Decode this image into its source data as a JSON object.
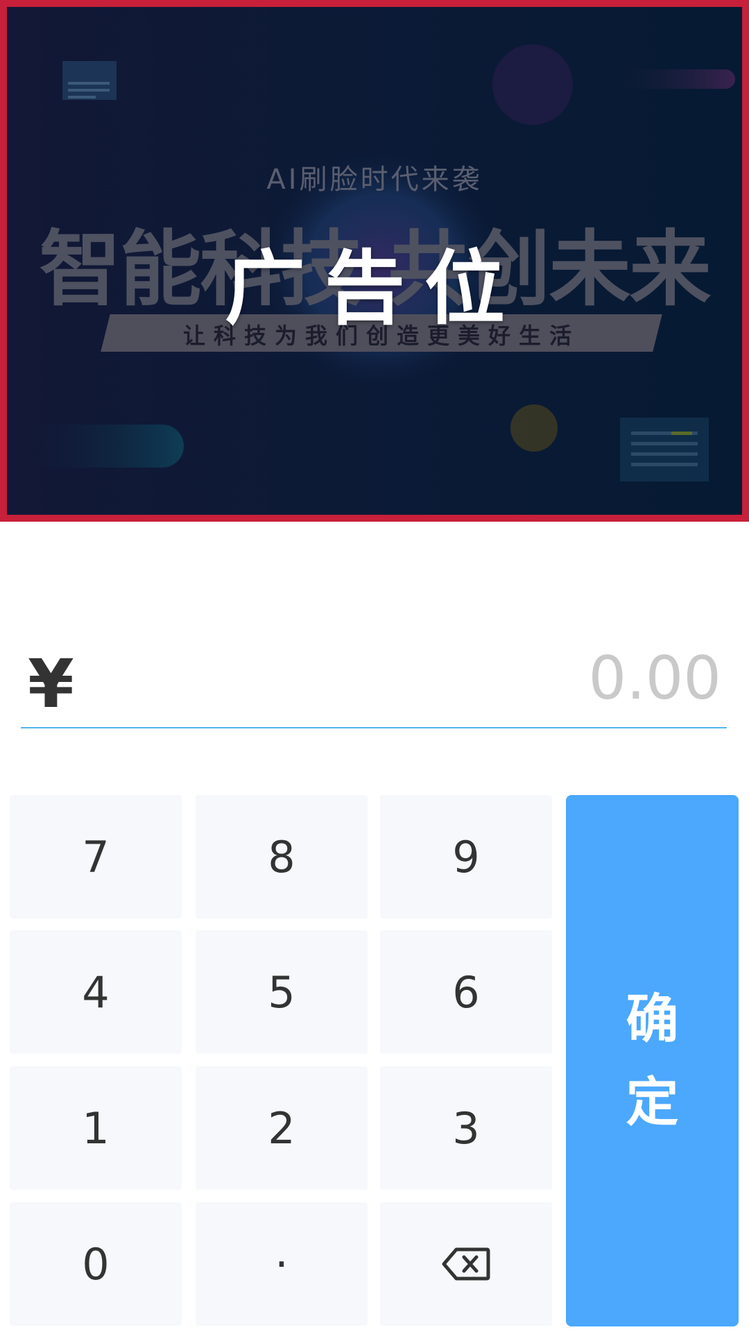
{
  "ad": {
    "subtitle": "AI刷脸时代来袭",
    "headline": "智能科技 共创未来",
    "slogan": "让科技为我们创造更美好生活",
    "overlay_label": "广告位",
    "border_color": "#c8203a"
  },
  "amount": {
    "currency_symbol": "¥",
    "placeholder": "0.00",
    "underline_color": "#53b4ee"
  },
  "keypad": {
    "keys": [
      "7",
      "8",
      "9",
      "4",
      "5",
      "6",
      "1",
      "2",
      "3",
      "0",
      "·"
    ],
    "backspace_icon": "backspace-icon",
    "confirm_label": "确定",
    "confirm_color": "#4ba8fd"
  }
}
